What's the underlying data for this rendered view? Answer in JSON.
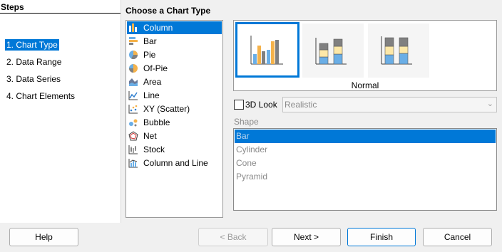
{
  "steps": {
    "title": "Steps",
    "items": [
      {
        "label": "1. Chart Type",
        "active": true
      },
      {
        "label": "2. Data Range",
        "active": false
      },
      {
        "label": "3. Data Series",
        "active": false
      },
      {
        "label": "4. Chart Elements",
        "active": false
      }
    ]
  },
  "main": {
    "title": "Choose a Chart Type",
    "chart_types": [
      {
        "label": "Column",
        "icon": "column-chart-icon",
        "selected": true
      },
      {
        "label": "Bar",
        "icon": "bar-chart-icon"
      },
      {
        "label": "Pie",
        "icon": "pie-chart-icon"
      },
      {
        "label": "Of-Pie",
        "icon": "of-pie-chart-icon"
      },
      {
        "label": "Area",
        "icon": "area-chart-icon"
      },
      {
        "label": "Line",
        "icon": "line-chart-icon"
      },
      {
        "label": "XY (Scatter)",
        "icon": "scatter-chart-icon"
      },
      {
        "label": "Bubble",
        "icon": "bubble-chart-icon"
      },
      {
        "label": "Net",
        "icon": "net-chart-icon"
      },
      {
        "label": "Stock",
        "icon": "stock-chart-icon"
      },
      {
        "label": "Column and Line",
        "icon": "column-and-line-chart-icon"
      }
    ],
    "variant_label": "Normal",
    "three_d": {
      "label": "3D Look",
      "checked": false,
      "look_value": "Realistic"
    },
    "shape": {
      "label": "Shape",
      "options": [
        "Bar",
        "Cylinder",
        "Cone",
        "Pyramid"
      ],
      "selected": "Bar"
    }
  },
  "buttons": {
    "help": "Help",
    "back": "< Back",
    "next": "Next >",
    "finish": "Finish",
    "cancel": "Cancel"
  },
  "colors": {
    "accent": "#0078d7",
    "bar_orange": "#f5b24a",
    "bar_blue": "#6aaee6",
    "bar_gray": "#808080",
    "bar_cream": "#fde8a8"
  }
}
